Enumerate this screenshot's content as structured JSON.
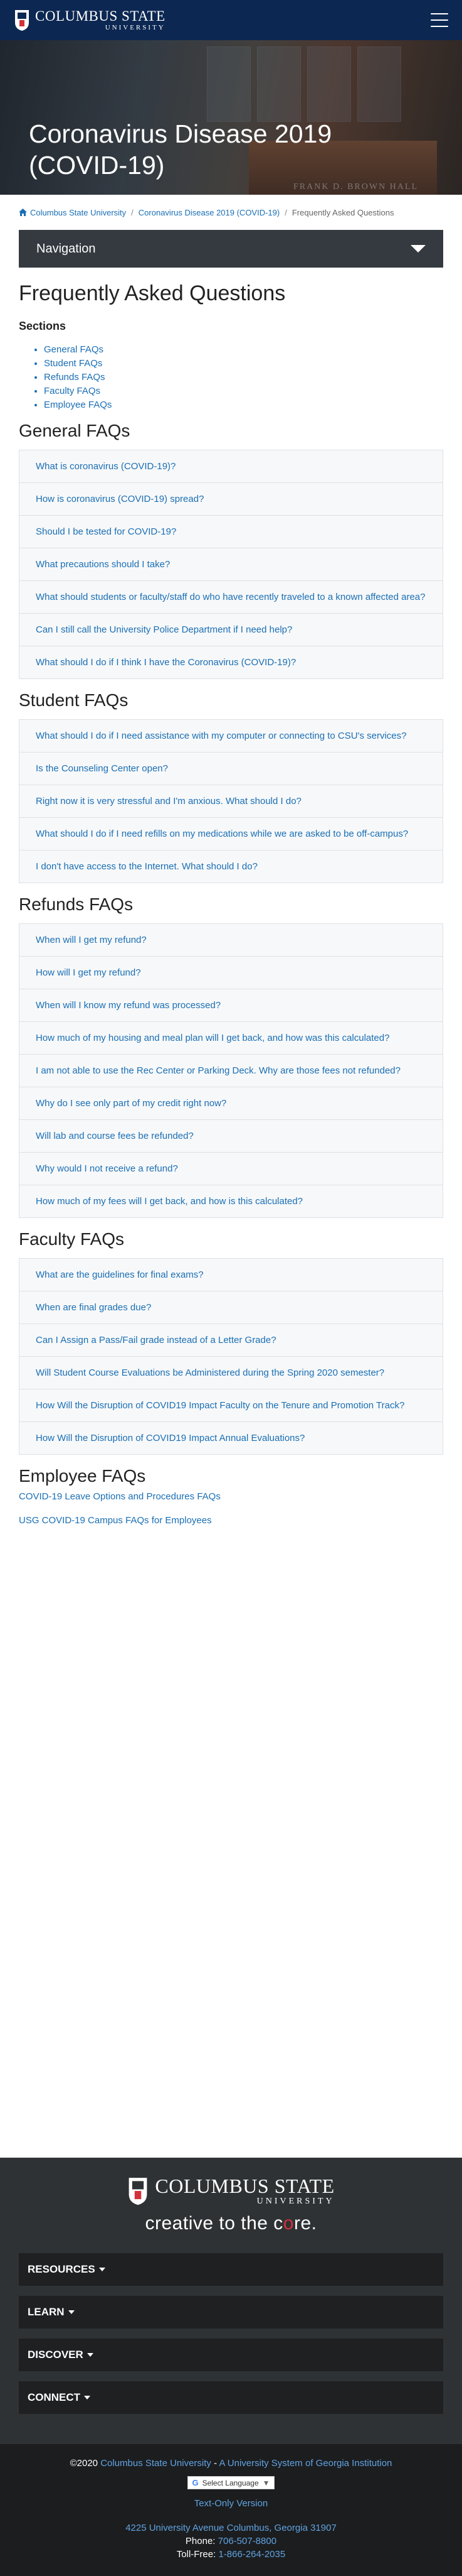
{
  "header": {
    "logo_name": "COLUMBUS STATE",
    "logo_sub": "UNIVERSITY"
  },
  "hero": {
    "title": "Coronavirus Disease 2019 (COVID-19)",
    "sign": "FRANK D. BROWN HALL"
  },
  "breadcrumb": {
    "items": [
      "Columbus State University",
      "Coronavirus Disease 2019 (COVID-19)",
      "Frequently Asked Questions"
    ],
    "separator": "/"
  },
  "nav": {
    "label": "Navigation"
  },
  "page": {
    "title": "Frequently Asked Questions",
    "sections_heading": "Sections",
    "sections": [
      "General FAQs",
      "Student FAQs",
      "Refunds FAQs",
      "Faculty FAQs",
      "Employee FAQs"
    ]
  },
  "general": {
    "heading": "General FAQs",
    "items": [
      "What is coronavirus (COVID-19)?",
      "How is coronavirus (COVID-19) spread?",
      "Should I be tested for COVID-19?",
      "What precautions should I take?",
      "What should students or faculty/staff do who have recently traveled to a known affected area?",
      "Can I still call the University Police Department if I need help?",
      "What should I do if I think I have the Coronavirus (COVID-19)?"
    ]
  },
  "student": {
    "heading": "Student FAQs",
    "items": [
      "What should I do if I need assistance with my computer or connecting to CSU's services?",
      "Is the Counseling Center open?",
      "Right now it is very stressful and I'm anxious. What should I do?",
      "What should I do if I need refills on my medications while we are asked to be off-campus?",
      "I don't have access to the Internet. What should I do?"
    ]
  },
  "refunds": {
    "heading": "Refunds FAQs",
    "items": [
      "When will I get my refund?",
      "How will I get my refund?",
      "When will I know my refund was processed?",
      "How much of my housing and meal plan will I get back, and how was this calculated?",
      "I am not able to use the Rec Center or Parking Deck. Why are those fees not refunded?",
      "Why do I see only part of my credit right now?",
      "Will lab and course fees be refunded?",
      "Why would I not receive a refund?",
      "How much of my fees will I get back, and how is this calculated?"
    ]
  },
  "faculty": {
    "heading": "Faculty FAQs",
    "items": [
      "What are the guidelines for final exams?",
      "When are final grades due?",
      "Can I Assign a Pass/Fail grade instead of a Letter Grade?",
      "Will Student Course Evaluations be Administered during the Spring 2020 semester?",
      "How Will the Disruption of COVID19 Impact Faculty on the Tenure and Promotion Track?",
      "How Will the Disruption of COVID19 Impact Annual Evaluations?"
    ]
  },
  "employee": {
    "heading": "Employee FAQs",
    "links": [
      "COVID-19 Leave Options and Procedures FAQs",
      "USG COVID-19 Campus FAQs for Employees"
    ]
  },
  "footer": {
    "logo_name": "COLUMBUS STATE",
    "logo_sub": "UNIVERSITY",
    "tagline_pre": "creative to the c",
    "tagline_o": "o",
    "tagline_post": "re.",
    "menus": [
      "RESOURCES",
      "LEARN",
      "DISCOVER",
      "CONNECT"
    ],
    "copyright_pre": "©2020 ",
    "copyright_link1": "Columbus State University",
    "copyright_mid": " - ",
    "copyright_link2": "A University System of Georgia Institution",
    "language": "Select Language",
    "text_only": "Text-Only Version",
    "address": "4225 University Avenue Columbus, Georgia 31907",
    "phone_label": "Phone: ",
    "phone": "706-507-8800",
    "tollfree_label": "Toll-Free: ",
    "tollfree": "1-866-264-2035"
  },
  "colors": {
    "header": "#0c2752",
    "link": "#1a6fb5",
    "footer": "#2f3234",
    "accent": "#d3313a"
  }
}
